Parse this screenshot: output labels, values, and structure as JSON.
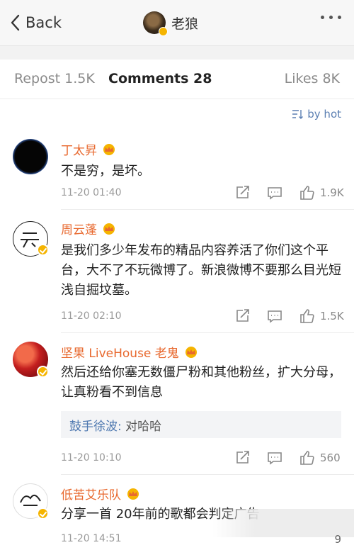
{
  "nav": {
    "back_label": "Back",
    "title": "老狼"
  },
  "tabs": {
    "repost": "Repost 1.5K",
    "comments": "Comments 28",
    "likes": "Likes 8K"
  },
  "sort_label": "by hot",
  "comments": [
    {
      "user": "丁太昇",
      "text": "不是穷，是坏。",
      "time": "11-20 01:40",
      "likes": "1.9K"
    },
    {
      "user": "周云蓬",
      "text": "是我们多少年发布的精品内容养活了你们这个平台，大不了不玩微博了。新浪微博不要那么目光短浅自掘坟墓。",
      "time": "11-20 02:10",
      "likes": "1.5K"
    },
    {
      "user": "坚果 LiveHouse 老鬼",
      "text": "然后还给你塞无数僵尸粉和其他粉丝，扩大分母，让真粉看不到信息",
      "time": "11-20 10:10",
      "likes": "560",
      "reply": {
        "who": "鼓手徐波:",
        "text": " 对哈哈"
      }
    },
    {
      "user": "低苦艾乐队",
      "text": "分享一首 20年前的歌都会判定广告",
      "time": "11-20 14:51",
      "likes": "9"
    }
  ],
  "colors": {
    "username": "#e8692f",
    "link": "#5b7fb2",
    "verified": "#f5b400"
  }
}
